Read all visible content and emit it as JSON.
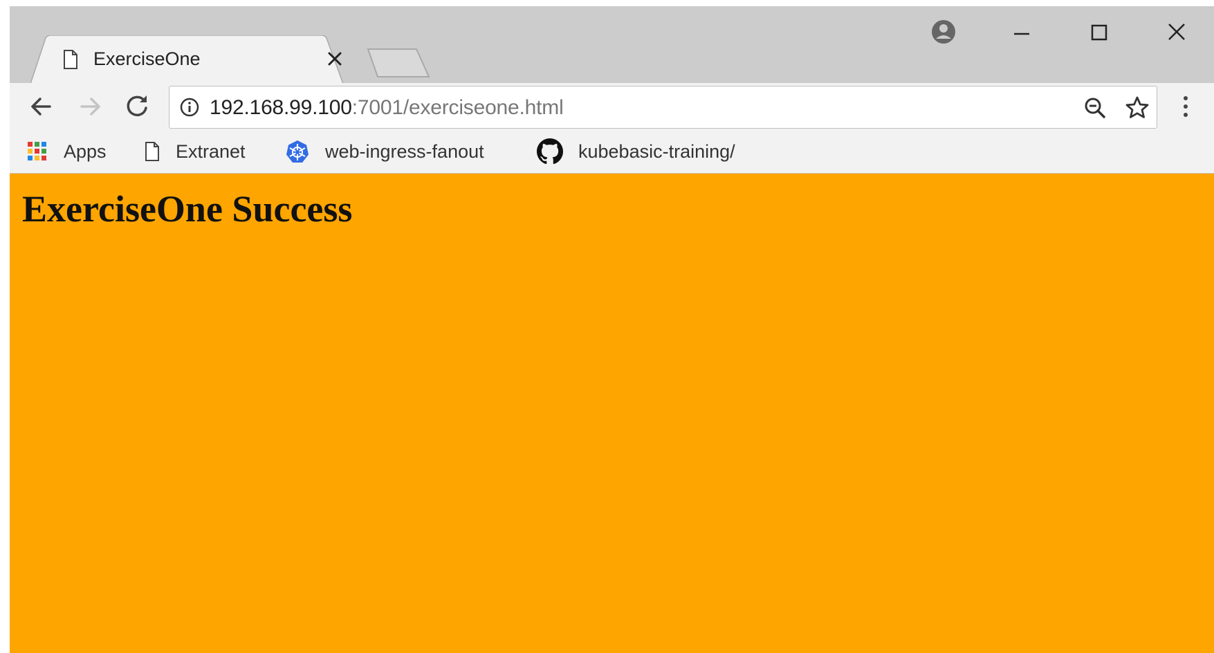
{
  "browser": {
    "tab": {
      "title": "ExerciseOne",
      "icon": "page-icon"
    },
    "address_bar": {
      "url_host": "192.168.99.100",
      "url_rest": ":7001/exerciseone.html"
    },
    "bookmarks": [
      {
        "label": "Apps",
        "icon": "apps-grid-icon"
      },
      {
        "label": "Extranet",
        "icon": "page-icon"
      },
      {
        "label": "web-ingress-fanout",
        "icon": "kubernetes-icon"
      },
      {
        "label": "kubebasic-training/",
        "icon": "github-icon"
      }
    ]
  },
  "page": {
    "heading": "ExerciseOne Success",
    "background_color": "#ffa500"
  }
}
